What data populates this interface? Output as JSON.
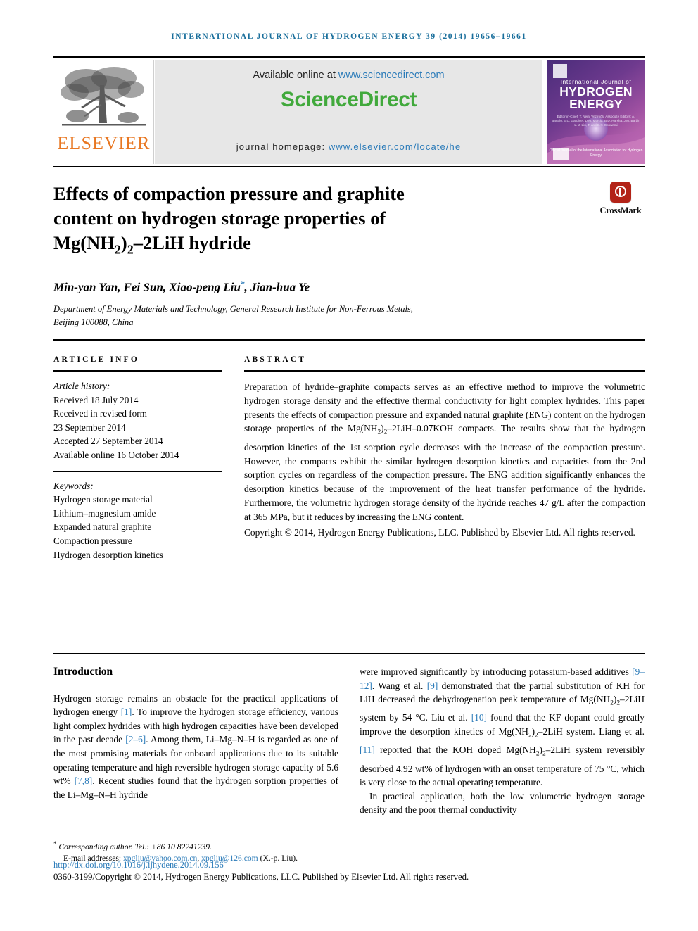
{
  "running_head": "International Journal of Hydrogen Energy 39 (2014) 19656–19661",
  "header": {
    "publisher_name": "ELSEVIER",
    "available_online_label": "Available online at ",
    "sciencedirect_url": "www.sciencedirect.com",
    "sciencedirect_logo": "ScienceDirect",
    "journal_homepage_label": "journal homepage: ",
    "journal_homepage_url": "www.elsevier.com/locate/he",
    "cover": {
      "line_small": "International Journal of",
      "line_big_1": "HYDROGEN",
      "line_big_2": "ENERGY",
      "editors": "Editor-in-Chief: T. Nejat Veziroğlu    Associate Editors: A. Bartolo, E.C. Gardiner, D.M. Murcia, B.D. Harsha, J.M. Barbir, L.-J. Liu, T. and D.Y. Goswami",
      "footer": "Official Journal of the International Association for Hydrogen Energy"
    }
  },
  "article": {
    "title_line_1": "Effects of compaction pressure and graphite",
    "title_line_2": "content on hydrogen storage properties of",
    "title_line_3_pre": "Mg(NH",
    "title_line_3_sub1": "2",
    "title_line_3_mid": ")",
    "title_line_3_sub2": "2",
    "title_line_3_post": "–2LiH hydride",
    "crossmark_label": "CrossMark",
    "authors": "Min-yan Yan, Fei Sun, Xiao-peng Liu",
    "authors_tail": ", Jian-hua Ye",
    "corresponding_marker": "*",
    "affiliation_line_1": "Department of Energy Materials and Technology, General Research Institute for Non-Ferrous Metals,",
    "affiliation_line_2": "Beijing 100088, China"
  },
  "article_info": {
    "heading": "ARTICLE INFO",
    "history_label": "Article history:",
    "history": [
      "Received 18 July 2014",
      "Received in revised form",
      "23 September 2014",
      "Accepted 27 September 2014",
      "Available online 16 October 2014"
    ],
    "keywords_label": "Keywords:",
    "keywords": [
      "Hydrogen storage material",
      "Lithium–magnesium amide",
      "Expanded natural graphite",
      "Compaction pressure",
      "Hydrogen desorption kinetics"
    ]
  },
  "abstract": {
    "heading": "ABSTRACT",
    "p1_a": "Preparation of hydride–graphite compacts serves as an effective method to improve the volumetric hydrogen storage density and the effective thermal conductivity for light complex hydrides. This paper presents the effects of compaction pressure and expanded natural graphite (ENG) content on the hydrogen storage properties of the Mg(NH",
    "p1_b": ")",
    "p1_c": "–2LiH–0.07KOH compacts. The results show that the hydrogen desorption kinetics of the 1st sorption cycle decreases with the increase of the compaction pressure. However, the compacts exhibit the similar hydrogen desorption kinetics and capacities from the 2nd sorption cycles on regardless of the compaction pressure. The ENG addition significantly enhances the desorption kinetics because of the improvement of the heat transfer performance of the hydride. Furthermore, the volumetric hydrogen storage density of the hydride reaches 47 g/L after the compaction at 365 MPa, but it reduces by increasing the ENG content.",
    "sub_2a": "2",
    "sub_2b": "2",
    "copyright": "Copyright © 2014, Hydrogen Energy Publications, LLC. Published by Elsevier Ltd. All rights reserved."
  },
  "body": {
    "section_title": "Introduction",
    "left_p1_seg1": "Hydrogen storage remains an obstacle for the practical applications of hydrogen energy ",
    "left_ref1": "[1]",
    "left_p1_seg2": ". To improve the hydrogen storage efficiency, various light complex hydrides with high hydrogen capacities have been developed in the past decade ",
    "left_ref2": "[2–6]",
    "left_p1_seg3": ". Among them, Li–Mg–N–H is regarded as one of the most promising materials for onboard applications due to its suitable operating temperature and high reversible hydrogen storage capacity of 5.6 wt% ",
    "left_ref3": "[7,8]",
    "left_p1_seg4": ". Recent studies found that the hydrogen sorption properties of the Li–Mg–N–H hydride",
    "right_p1_seg1": "were improved significantly by introducing potassium-based additives ",
    "right_ref1": "[9–12]",
    "right_p1_seg2": ". Wang et al. ",
    "right_ref2": "[9]",
    "right_p1_seg3": " demonstrated that the partial substitution of KH for LiH decreased the dehydrogenation peak temperature of Mg(NH",
    "right_p1_seg4": ")",
    "right_p1_seg5": "–2LiH system by 54 °C. Liu et al. ",
    "right_ref3": "[10]",
    "right_p1_seg6": " found that the KF dopant could greatly improve the desorption kinetics of Mg(NH",
    "right_p1_seg7": ")",
    "right_p1_seg8": "–2LiH system. Liang et al. ",
    "right_ref4": "[11]",
    "right_p1_seg9": " reported that the KOH doped Mg(NH",
    "right_p1_seg10": ")",
    "right_p1_seg11": "–2LiH system reversibly desorbed 4.92 wt% of hydrogen with an onset temperature of 75 °C, which is very close to the actual operating temperature.",
    "right_p2": "In practical application, both the low volumetric hydrogen storage density and the poor thermal conductivity",
    "sub": "2"
  },
  "footnote": {
    "marker": "*",
    "corresponding": " Corresponding author. Tel.: +86 10 82241239.",
    "email_label": "E-mail addresses: ",
    "email1": "xpgliu@yahoo.com.cn",
    "email_sep": ", ",
    "email2": "xpgliu@126.com",
    "email_tail": " (X.-p. Liu).",
    "doi": "http://dx.doi.org/10.1016/j.ijhydene.2014.09.156",
    "issn_line": "0360-3199/Copyright © 2014, Hydrogen Energy Publications, LLC. Published by Elsevier Ltd. All rights reserved."
  },
  "colors": {
    "link_blue": "#2b7bb9",
    "running_head_blue": "#1a6f9c",
    "elsevier_orange": "#e87722",
    "sciencedirect_green": "#41a93c",
    "crossmark_red": "#b32317"
  }
}
